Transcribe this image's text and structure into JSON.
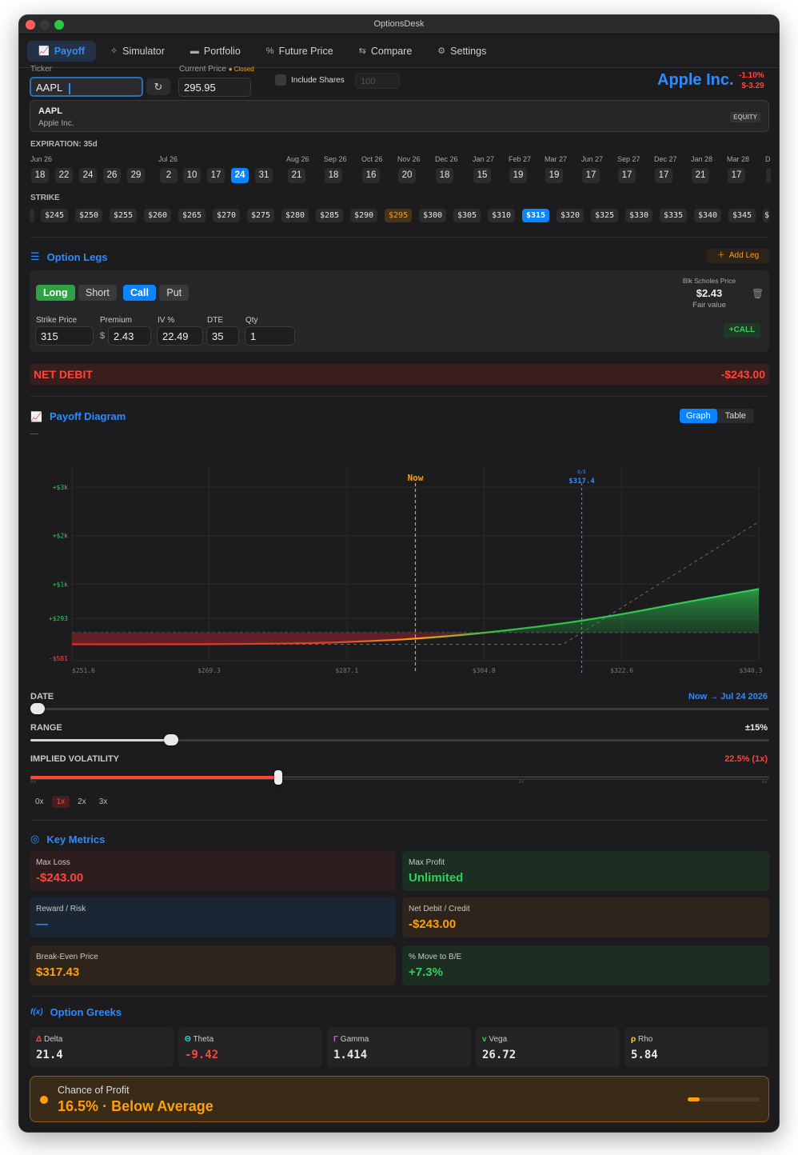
{
  "window": {
    "title": "OptionsDesk"
  },
  "tabs": [
    {
      "label": "Payoff",
      "icon": "chart-line-icon",
      "active": true
    },
    {
      "label": "Simulator",
      "icon": "sparkle-icon"
    },
    {
      "label": "Portfolio",
      "icon": "briefcase-icon"
    },
    {
      "label": "Future Price",
      "icon": "percent-icon"
    },
    {
      "label": "Compare",
      "icon": "swap-icon"
    },
    {
      "label": "Settings",
      "icon": "gear-icon"
    }
  ],
  "ticker": {
    "label": "Ticker",
    "value": "AAPL",
    "current_price_label": "Current Price",
    "market_status": "Closed",
    "current_price": "295.95",
    "include_shares_label": "Include Shares",
    "shares_placeholder": "100",
    "company": "Apple Inc.",
    "change_pct": "-1.10%",
    "change_abs": "$-3.29",
    "suggestion": {
      "symbol": "AAPL",
      "name": "Apple Inc.",
      "type": "EQUITY"
    }
  },
  "expiration": {
    "label": "EXPIRATION: 35d",
    "months": [
      "Jun 26",
      "Jul 26",
      "Aug 26",
      "Sep 26",
      "Oct 26",
      "Nov 26",
      "Dec 26",
      "Jan 27",
      "Feb 27",
      "Mar 27",
      "Jun 27",
      "Sep 27",
      "Dec 27",
      "Jan 28",
      "Mar 28",
      "D"
    ],
    "dates": [
      "18",
      "22",
      "24",
      "26",
      "29",
      "2",
      "10",
      "17",
      "24",
      "31",
      "21",
      "18",
      "16",
      "20",
      "18",
      "15",
      "19",
      "19",
      "17",
      "17",
      "17",
      "21",
      "17"
    ],
    "selected": "24"
  },
  "strike": {
    "label": "STRIKE",
    "values": [
      "$245",
      "$250",
      "$255",
      "$260",
      "$265",
      "$270",
      "$275",
      "$280",
      "$285",
      "$290",
      "$295",
      "$300",
      "$305",
      "$310",
      "$315",
      "$320",
      "$325",
      "$330",
      "$335",
      "$340",
      "$345",
      "$"
    ],
    "atm": "$295",
    "selected": "$315"
  },
  "legs": {
    "title": "Option Legs",
    "add_label": "Add Leg",
    "long": "Long",
    "short": "Short",
    "call": "Call",
    "put": "Put",
    "bs_label": "Blk Scholes Price",
    "bs_price": "$2.43",
    "bs_sub": "Fair value",
    "leg_tag": "+CALL",
    "fields": {
      "strike_label": "Strike Price",
      "strike": "315",
      "premium_label": "Premium",
      "currency": "$",
      "premium": "2.43",
      "iv_label": "IV %",
      "iv": "22.49",
      "dte_label": "DTE",
      "dte": "35",
      "qty_label": "Qty",
      "qty": "1"
    },
    "net_label": "NET DEBIT",
    "net_value": "-$243.00"
  },
  "payoff": {
    "title": "Payoff Diagram",
    "graph": "Graph",
    "table": "Table",
    "dash": "—",
    "now_label": "Now",
    "be_small": "B/E",
    "be_label": "$317.4",
    "y_ticks": [
      "+$3k",
      "+$2k",
      "+$1k",
      "+$293",
      "-$581"
    ],
    "x_ticks": [
      "$251.6",
      "$269.3",
      "$287.1",
      "$304.8",
      "$322.6",
      "$340.3"
    ],
    "iv_ticks": [
      "0x",
      "2x",
      "3x"
    ]
  },
  "chart_data": {
    "type": "area",
    "x": [
      251.6,
      260,
      269.3,
      280,
      287.1,
      295.95,
      304.8,
      315,
      322.6,
      330,
      340.3
    ],
    "series": [
      {
        "values": [
          -243,
          -243,
          -240,
          -225,
          -195,
          -125,
          -5,
          190,
          380,
          600,
          900
        ]
      },
      {
        "values": [
          -243,
          -243,
          -243,
          -243,
          -243,
          -243,
          -243,
          -243,
          517,
          1257,
          2287
        ]
      }
    ],
    "now": 295.95,
    "breakeven": 317.43
  },
  "controls": {
    "date_label": "DATE",
    "date_value": "Now → Jul 24 2026",
    "date_fraction": 0,
    "range_label": "RANGE",
    "range_value": "±15%",
    "range_fraction": 0.19,
    "iv_label": "IMPLIED VOLATILITY",
    "iv_value": "22.5% (1x)",
    "iv_fraction": 0.335,
    "iv_presets": [
      "0x",
      "1x",
      "2x",
      "3x"
    ],
    "iv_active": "1x"
  },
  "metrics": {
    "title": "Key Metrics",
    "max_loss_label": "Max Loss",
    "max_loss": "-$243.00",
    "max_profit_label": "Max Profit",
    "max_profit": "Unlimited",
    "rr_label": "Reward / Risk",
    "rr": "—",
    "net_label": "Net Debit / Credit",
    "net": "-$243.00",
    "be_label": "Break-Even Price",
    "be": "$317.43",
    "move_label": "% Move to B/E",
    "move": "+7.3%"
  },
  "greeks": {
    "title": "Option Greeks",
    "items": [
      {
        "symbol": "Δ",
        "label": "Delta",
        "value": "21.4",
        "color": "#ff453a"
      },
      {
        "symbol": "Θ",
        "label": "Theta",
        "value": "-9.42",
        "color": "#30d5c8"
      },
      {
        "symbol": "Γ",
        "label": "Gamma",
        "value": "1.414",
        "color": "#bf5af2"
      },
      {
        "symbol": "v",
        "label": "Vega",
        "value": "26.72",
        "color": "#30d158"
      },
      {
        "symbol": "ρ",
        "label": "Rho",
        "value": "5.84",
        "color": "#ffd60a"
      }
    ]
  },
  "chance": {
    "label": "Chance of Profit",
    "value": "16.5%",
    "sep": "·",
    "rating": "Below Average",
    "fraction": 0.165
  }
}
